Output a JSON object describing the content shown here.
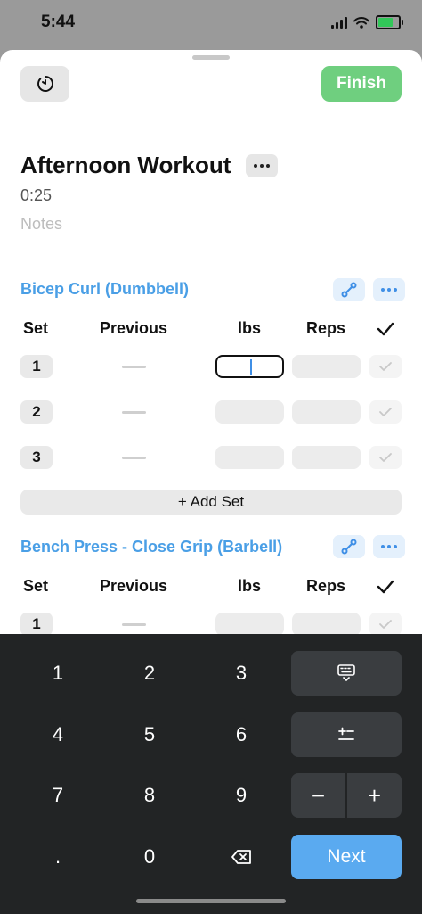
{
  "status_bar": {
    "time": "5:44"
  },
  "header": {
    "finish_label": "Finish"
  },
  "workout": {
    "title": "Afternoon Workout",
    "duration": "0:25",
    "notes_placeholder": "Notes"
  },
  "columns": {
    "set": "Set",
    "previous": "Previous",
    "lbs": "lbs",
    "reps": "Reps"
  },
  "exercises": [
    {
      "name": "Bicep Curl (Dumbbell)",
      "sets": [
        "1",
        "2",
        "3"
      ],
      "add_set_label": "+ Add Set"
    },
    {
      "name": "Bench Press - Close Grip (Barbell)",
      "sets": [
        "1"
      ]
    }
  ],
  "keypad": {
    "keys": [
      "1",
      "2",
      "3",
      "4",
      "5",
      "6",
      "7",
      "8",
      "9",
      ".",
      "0"
    ],
    "minus": "−",
    "plus": "+",
    "next_label": "Next"
  },
  "colors": {
    "accent": "#4a9fe6",
    "finish": "#6fcf7f",
    "keypad_bg": "#222425",
    "next": "#5aaaf0"
  }
}
